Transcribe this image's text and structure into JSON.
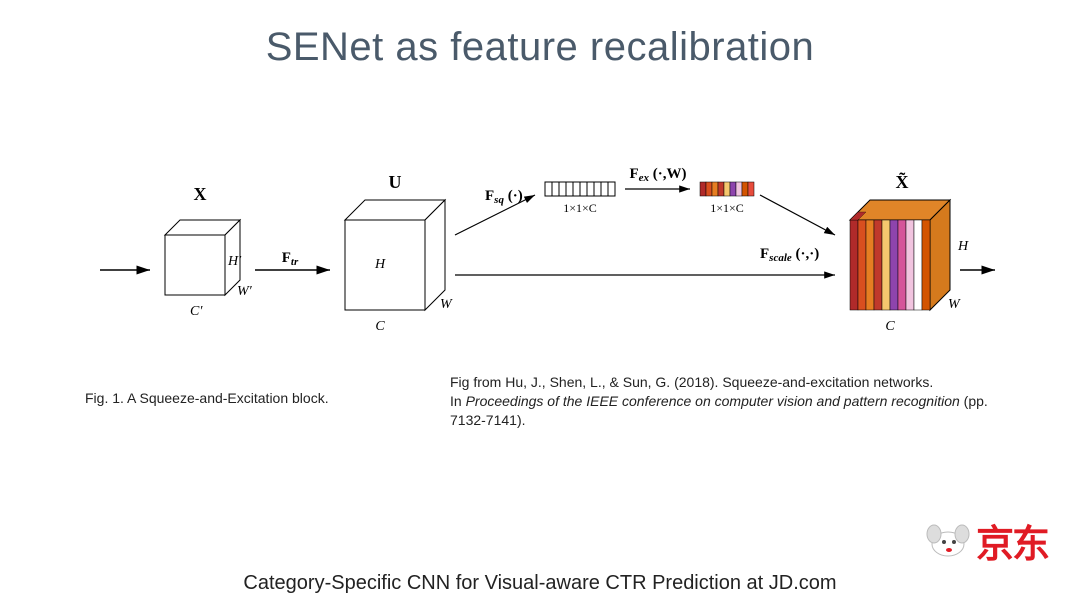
{
  "title": "SENet as feature recalibration",
  "diagram": {
    "block1": {
      "label": "X",
      "h": "H′",
      "w": "W′",
      "c": "C′"
    },
    "arrow1": "F_tr",
    "block2": {
      "label": "U",
      "h": "H",
      "w": "W",
      "c": "C"
    },
    "squeeze": {
      "label": "F_sq (·)",
      "size": "1×1×C"
    },
    "excite": {
      "label": "F_ex (·,W)",
      "size": "1×1×C"
    },
    "scale": "F_scale (·,·)",
    "block3": {
      "label": "X̃",
      "h": "H",
      "w": "W",
      "c": "C"
    }
  },
  "caption1": "Fig. 1. A Squeeze-and-Excitation block.",
  "caption2_line1": "Fig from Hu, J., Shen, L., & Sun, G. (2018). Squeeze-and-excitation networks.",
  "caption2_line2a": "In ",
  "caption2_line2b": "Proceedings of the IEEE conference on computer vision and pattern recognition",
  "caption2_line2c": " (pp. 7132-7141).",
  "footer": "Category-Specific CNN for Visual-aware CTR Prediction at JD.com",
  "jd_text": "京东"
}
